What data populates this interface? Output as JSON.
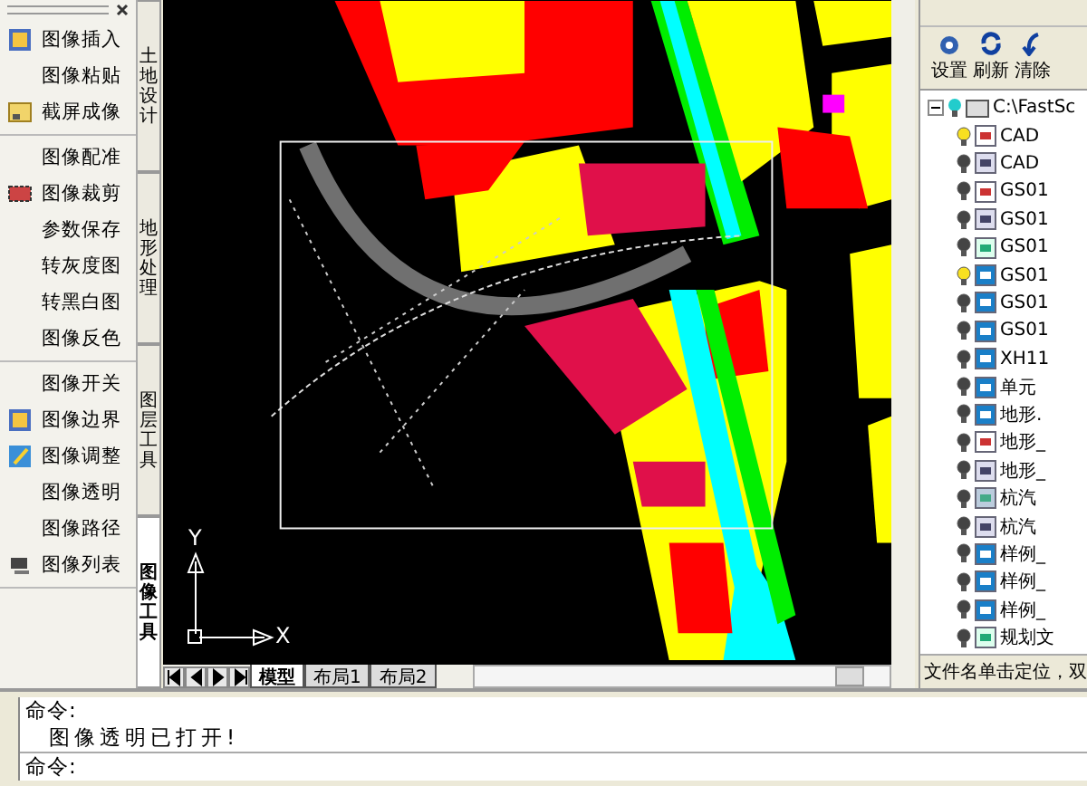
{
  "left_panel": {
    "groups": [
      [
        {
          "label": "图像插入",
          "kind": "insert"
        },
        {
          "label": "图像粘贴",
          "kind": "plain"
        },
        {
          "label": "截屏成像",
          "kind": "capture"
        }
      ],
      [
        {
          "label": "图像配准",
          "kind": "plain"
        },
        {
          "label": "图像裁剪",
          "kind": "crop"
        },
        {
          "label": "参数保存",
          "kind": "plain"
        },
        {
          "label": "转灰度图",
          "kind": "plain"
        },
        {
          "label": "转黑白图",
          "kind": "plain"
        },
        {
          "label": "图像反色",
          "kind": "plain"
        }
      ],
      [
        {
          "label": "图像开关",
          "kind": "plain"
        },
        {
          "label": "图像边界",
          "kind": "insert"
        },
        {
          "label": "图像调整",
          "kind": "adjust"
        },
        {
          "label": "图像透明",
          "kind": "plain"
        },
        {
          "label": "图像路径",
          "kind": "plain"
        },
        {
          "label": "图像列表",
          "kind": "list"
        }
      ]
    ]
  },
  "side_tabs": [
    {
      "label": "土地设计",
      "selected": false
    },
    {
      "label": "地形处理",
      "selected": false
    },
    {
      "label": "图层工具",
      "selected": false
    },
    {
      "label": "图像工具",
      "selected": true
    }
  ],
  "canvas": {
    "axis_y": "Y",
    "axis_x": "X",
    "layout_tabs": [
      {
        "label": "模型",
        "selected": true
      },
      {
        "label": "布局1",
        "selected": false
      },
      {
        "label": "布局2",
        "selected": false
      }
    ]
  },
  "right_panel": {
    "toolbar": [
      {
        "label": "设置",
        "kind": "settings"
      },
      {
        "label": "刷新",
        "kind": "refresh"
      },
      {
        "label": "清除",
        "kind": "clear"
      }
    ],
    "tree": {
      "label": "C:\\FastSc",
      "expanded": true,
      "children": [
        {
          "label": "CAD",
          "on": true,
          "kind": "pdf"
        },
        {
          "label": "CAD",
          "on": false,
          "kind": "dwg"
        },
        {
          "label": "GS01",
          "on": false,
          "kind": "pdf"
        },
        {
          "label": "GS01",
          "on": false,
          "kind": "dwg"
        },
        {
          "label": "GS01",
          "on": false,
          "kind": "sheet"
        },
        {
          "label": "GS01",
          "on": true,
          "kind": "img"
        },
        {
          "label": "GS01",
          "on": false,
          "kind": "img"
        },
        {
          "label": "GS01",
          "on": false,
          "kind": "img"
        },
        {
          "label": "XH11",
          "on": false,
          "kind": "img"
        },
        {
          "label": "单元",
          "on": false,
          "kind": "img"
        },
        {
          "label": "地形.",
          "on": false,
          "kind": "img"
        },
        {
          "label": "地形_",
          "on": false,
          "kind": "pdf"
        },
        {
          "label": "地形_",
          "on": false,
          "kind": "dwg"
        },
        {
          "label": "杭汽",
          "on": false,
          "kind": "photo"
        },
        {
          "label": "杭汽",
          "on": false,
          "kind": "dwg"
        },
        {
          "label": "样例_",
          "on": false,
          "kind": "img"
        },
        {
          "label": "样例_",
          "on": false,
          "kind": "img"
        },
        {
          "label": "样例_",
          "on": false,
          "kind": "img"
        },
        {
          "label": "规划文",
          "on": false,
          "kind": "sheet"
        }
      ]
    },
    "status": "文件名单击定位，双"
  },
  "command": {
    "lines": [
      {
        "text": "命令:",
        "kind": "prompt"
      },
      {
        "text": "图像透明已打开!",
        "kind": "message"
      },
      {
        "text": "命令:",
        "kind": "prompt"
      }
    ]
  }
}
